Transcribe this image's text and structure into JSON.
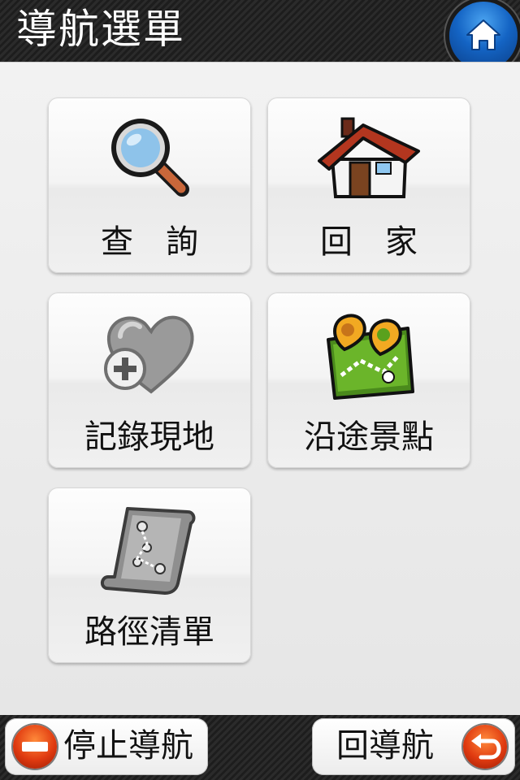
{
  "header": {
    "title": "導航選單"
  },
  "home": {
    "icon": "home-icon"
  },
  "menu": {
    "items": [
      {
        "label": "查　詢",
        "icon": "magnifier-icon"
      },
      {
        "label": "回　家",
        "icon": "house-icon"
      },
      {
        "label": "記錄現地",
        "icon": "heart-plus-icon"
      },
      {
        "label": "沿途景點",
        "icon": "map-pins-icon"
      },
      {
        "label": "路徑清單",
        "icon": "route-scroll-icon"
      }
    ]
  },
  "footer": {
    "stop_label": "停止導航",
    "stop_icon": "stop-minus-icon",
    "return_label": "回導航",
    "return_icon": "return-arrow-icon"
  }
}
